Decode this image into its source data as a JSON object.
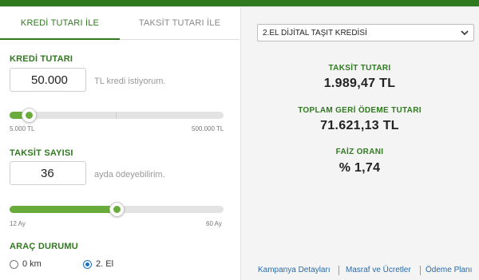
{
  "tabs": {
    "active": "KREDİ TUTARI İLE",
    "inactive": "TAKSİT TUTARI İLE"
  },
  "loan_amount": {
    "label": "KREDİ TUTARI",
    "value": "50.000",
    "hint": "TL kredi istiyorum.",
    "min_label": "5.000 TL",
    "max_label": "500.000 TL",
    "slider_fraction": 0.09
  },
  "installments": {
    "label": "TAKSİT SAYISI",
    "value": "36",
    "hint": "ayda ödeyebilirim.",
    "min_label": "12 Ay",
    "max_label": "60 Ay",
    "slider_fraction": 0.5
  },
  "vehicle": {
    "label": "ARAÇ DURUMU",
    "options": [
      "0 km",
      "2. El"
    ],
    "selected": "2. El"
  },
  "product_select": {
    "value": "2.EL DİJİTAL TAŞIT KREDİSİ"
  },
  "results": {
    "installment_label": "TAKSİT TUTARI",
    "installment_value": "1.989,47 TL",
    "total_label": "TOPLAM GERİ ÖDEME TUTARI",
    "total_value": "71.621,13 TL",
    "rate_label": "FAİZ ORANI",
    "rate_value": "% 1,74"
  },
  "footer_links": [
    "Kampanya Detayları",
    "Masraf ve Ücretler",
    "Ödeme Planı"
  ],
  "colors": {
    "brand_green": "#2f7a1f",
    "slider_green": "#6aac3c",
    "link_blue": "#2a6aa8"
  },
  "icons": {
    "select_chevron": "chevron-down-icon"
  }
}
